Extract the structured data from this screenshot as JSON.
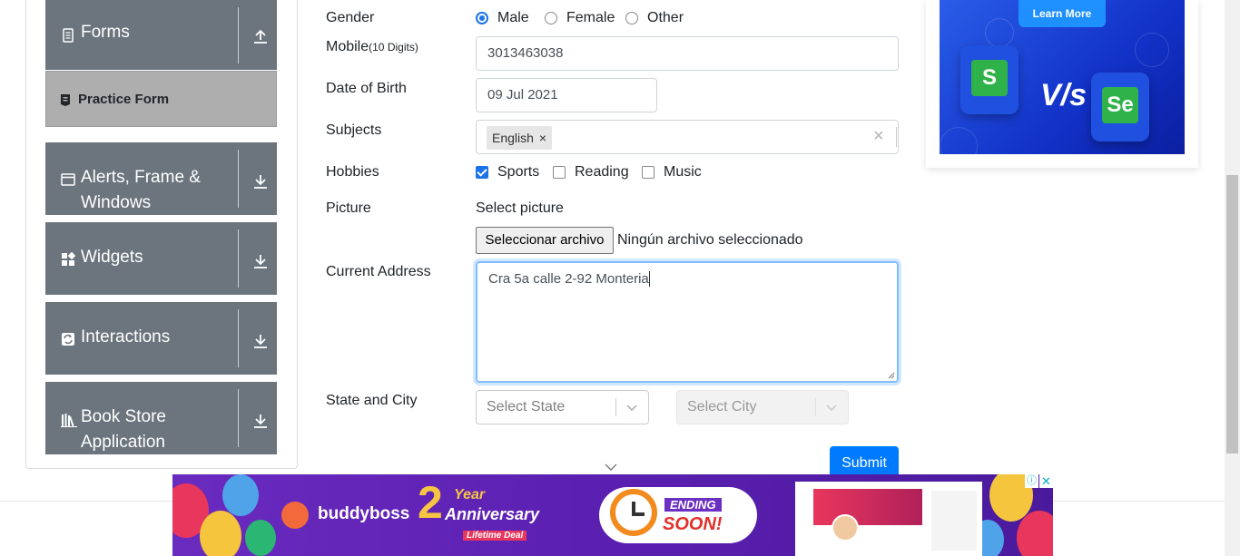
{
  "sidebar": {
    "groups": [
      {
        "title": "Forms",
        "icon": "document-icon",
        "arrow": "upload-arrow-icon"
      },
      {
        "title": "Alerts, Frame &",
        "title2": "Windows",
        "icon": "window-icon",
        "arrow": "download-arrow-icon"
      },
      {
        "title": "Widgets",
        "icon": "widgets-icon",
        "arrow": "download-arrow-icon"
      },
      {
        "title": "Interactions",
        "icon": "interactions-icon",
        "arrow": "download-arrow-icon"
      },
      {
        "title": "Book Store",
        "title2": "Application",
        "icon": "books-icon",
        "arrow": "download-arrow-icon"
      }
    ],
    "active_item": {
      "label": "Practice Form",
      "icon": "form-icon"
    }
  },
  "form": {
    "gender": {
      "label": "Gender",
      "options": [
        {
          "label": "Male",
          "checked": true
        },
        {
          "label": "Female",
          "checked": false
        },
        {
          "label": "Other",
          "checked": false
        }
      ]
    },
    "mobile": {
      "label": "Mobile",
      "hint": "(10 Digits)",
      "value": "3013463038"
    },
    "dob": {
      "label": "Date of Birth",
      "value": "09 Jul 2021"
    },
    "subjects": {
      "label": "Subjects",
      "chips": [
        "English"
      ]
    },
    "hobbies": {
      "label": "Hobbies",
      "options": [
        {
          "label": "Sports",
          "checked": true
        },
        {
          "label": "Reading",
          "checked": false
        },
        {
          "label": "Music",
          "checked": false
        }
      ]
    },
    "picture": {
      "label": "Picture",
      "caption": "Select picture",
      "button": "Seleccionar archivo",
      "status": "Ningún archivo seleccionado"
    },
    "address": {
      "label": "Current Address",
      "value": "Cra 5a calle 2-92 Monteria"
    },
    "state_city": {
      "label": "State and City",
      "state_placeholder": "Select State",
      "city_placeholder": "Select City"
    },
    "submit_label": "Submit"
  },
  "ads": {
    "right": {
      "button": "Learn More",
      "vs": "V/s",
      "left_logo": "S",
      "right_logo": "Se"
    },
    "bottom": {
      "brand": "buddyboss",
      "anniversary": "Year",
      "anniversary_number": "2",
      "anniversary_word": "Anniversary",
      "deal": "Lifetime Deal",
      "ending_top": "ENDING",
      "ending_bottom": "SOON!"
    }
  },
  "colors": {
    "sidebar_bg": "#6c757d",
    "active_bg": "#aeaeae",
    "primary": "#007bff",
    "check_blue": "#1a73e8"
  }
}
